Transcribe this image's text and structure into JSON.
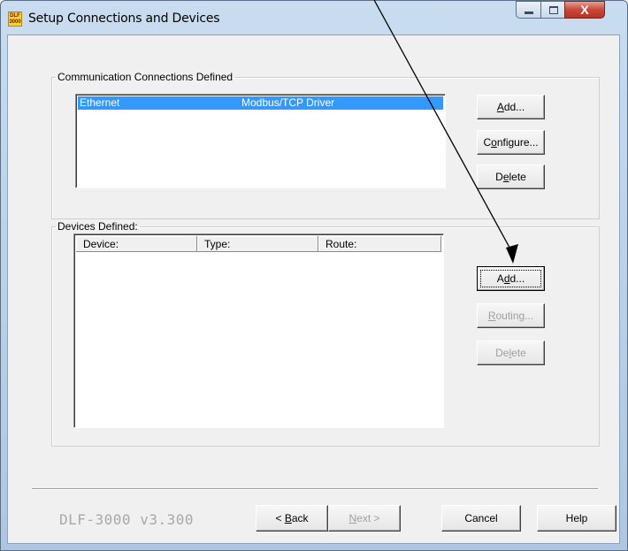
{
  "window": {
    "title": "Setup Connections and Devices",
    "icon_text": "DLF 3000",
    "close_symbol": "X"
  },
  "connections_group": {
    "label": "Communication Connections Defined",
    "items": [
      {
        "name": "Ethernet",
        "driver": "Modbus/TCP Driver",
        "selected": true
      }
    ],
    "buttons": {
      "add": {
        "pre": "",
        "u": "A",
        "post": "dd..."
      },
      "configure": {
        "pre": "C",
        "u": "o",
        "post": "nfigure..."
      },
      "delete": {
        "pre": "D",
        "u": "e",
        "post": "lete"
      }
    }
  },
  "devices_group": {
    "label": "Devices Defined:",
    "columns": [
      "Device:",
      "Type:",
      "Route:"
    ],
    "rows": [],
    "buttons": {
      "add": {
        "pre": "A",
        "u": "d",
        "post": "d..."
      },
      "routing": {
        "pre": "",
        "u": "R",
        "post": "outing..."
      },
      "delete": {
        "pre": "De",
        "u": "l",
        "post": "ete"
      }
    }
  },
  "footer": {
    "version": "DLF-3000 v3.300",
    "back": {
      "pre": "< ",
      "u": "B",
      "post": "ack"
    },
    "next": {
      "pre": "",
      "u": "N",
      "post": "ext >"
    },
    "cancel": "Cancel",
    "help": "Help"
  },
  "colors": {
    "selection": "#3399ff",
    "annotation_arrow": "#000000"
  }
}
